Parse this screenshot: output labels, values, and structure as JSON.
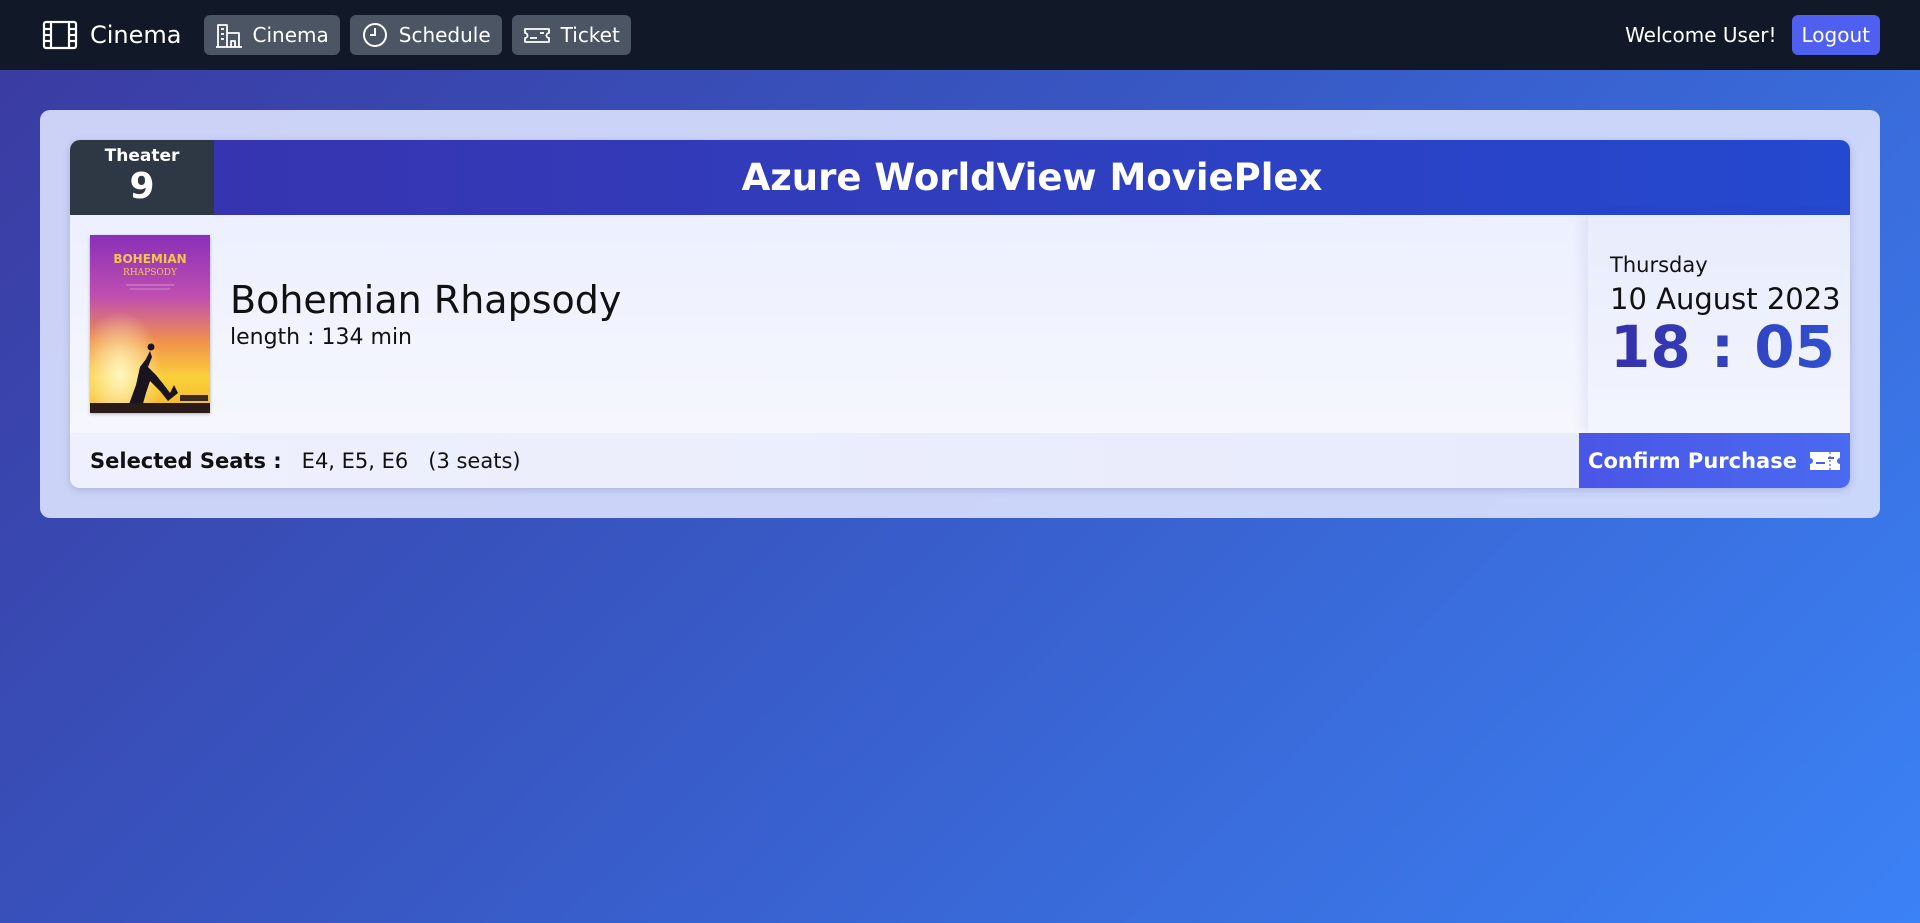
{
  "navbar": {
    "brand": "Cinema",
    "items": [
      {
        "label": "Cinema",
        "icon": "building-icon"
      },
      {
        "label": "Schedule",
        "icon": "clock-icon"
      },
      {
        "label": "Ticket",
        "icon": "ticket-icon"
      }
    ],
    "welcome": "Welcome User!",
    "logout_label": "Logout"
  },
  "ticket": {
    "theater_label": "Theater",
    "theater_number": "9",
    "cinema_name": "Azure WorldView MoviePlex",
    "movie": {
      "title": "Bohemian Rhapsody",
      "length_text": "length : 134 min",
      "poster_title": "BOHEMIAN",
      "poster_subtitle": "RHAPSODY"
    },
    "weekday": "Thursday",
    "date": "10 August 2023",
    "time": "18 : 05",
    "seats_label": "Selected Seats :",
    "seats": "E4, E5, E6",
    "seats_count": "(3 seats)",
    "confirm_label": "Confirm Purchase"
  },
  "colors": {
    "navbar_bg": "#111827",
    "nav_item_bg": "#4b5563",
    "logout_bg": "#4f5ff0",
    "theater_box_bg": "#2e3744",
    "header_blue": "#2f3fbf",
    "confirm_bg": "#4a5ee8"
  }
}
